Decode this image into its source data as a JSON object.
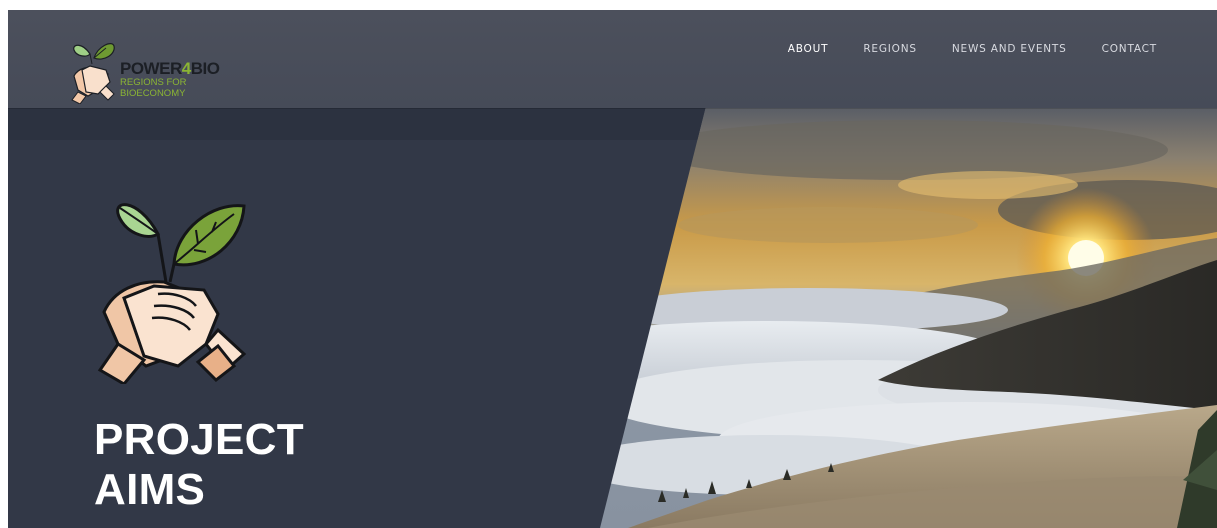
{
  "brand": {
    "name_part1": "POWER",
    "name_accent": "4",
    "name_part2": "BIO",
    "tagline_line1": "REGIONS FOR",
    "tagline_line2": "BIOECONOMY",
    "accent_color": "#8bb534"
  },
  "nav": {
    "items": [
      {
        "label": "ABOUT",
        "active": true
      },
      {
        "label": "REGIONS",
        "active": false
      },
      {
        "label": "NEWS AND EVENTS",
        "active": false
      },
      {
        "label": "CONTACT",
        "active": false
      }
    ]
  },
  "hero": {
    "title_line1": "PROJECT",
    "title_line2": "AIMS",
    "icon": "handshake-leaves-icon",
    "image": "sunset-mountain-fog-image",
    "panel_color": "#323847"
  }
}
